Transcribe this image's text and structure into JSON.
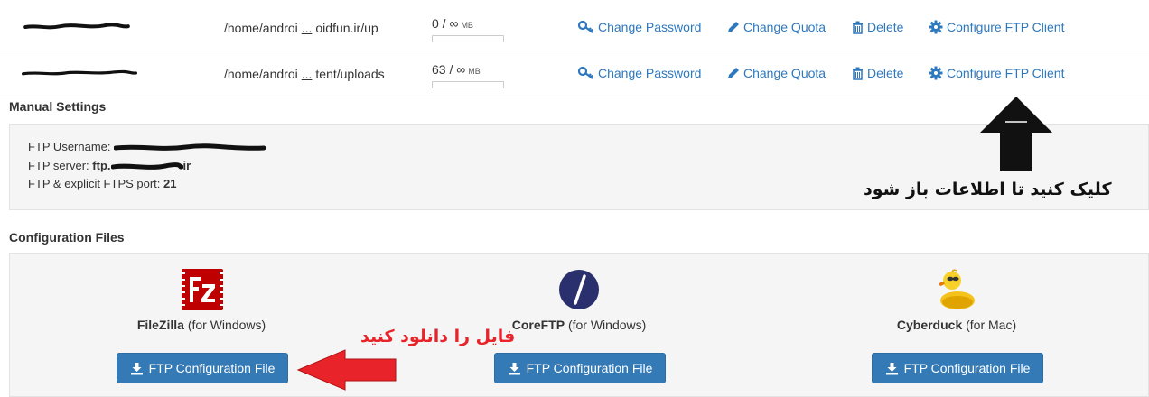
{
  "accounts": [
    {
      "path_start": "/home/androi",
      "path_ellipsis": "...",
      "path_end": "oidfun.ir/up",
      "quota_text": "0 / ∞",
      "quota_unit": "MB",
      "quota_fraction": 0
    },
    {
      "path_start": "/home/androi",
      "path_ellipsis": "...",
      "path_end": "tent/uploads",
      "quota_text": "63 / ∞",
      "quota_unit": "MB",
      "quota_fraction": 0
    }
  ],
  "actions": {
    "change_password": "Change Password",
    "change_quota": "Change Quota",
    "delete": "Delete",
    "configure_ftp": "Configure FTP Client"
  },
  "manual": {
    "title": "Manual Settings",
    "username_label": "FTP Username:",
    "server_label": "FTP server:",
    "server_value_prefix": "ftp.",
    "server_value_suffix": "ir",
    "port_label": "FTP & explicit FTPS port:",
    "port_value": "21"
  },
  "annotations": {
    "click_hint": "کلیک کنید تا اطلاعات باز شود",
    "download_hint": "فایل را دانلود کنید"
  },
  "config": {
    "title": "Configuration Files",
    "clients": [
      {
        "name": "FileZilla",
        "platform": "(for Windows)",
        "icon": "filezilla-icon"
      },
      {
        "name": "CoreFTP",
        "platform": "(for Windows)",
        "icon": "coreftp-icon"
      },
      {
        "name": "Cyberduck",
        "platform": "(for Mac)",
        "icon": "cyberduck-icon"
      }
    ],
    "button_label": "FTP Configuration File"
  },
  "colors": {
    "link": "#2e78bd",
    "button": "#337ab7",
    "annotation_red": "#e8242a",
    "filezilla_red": "#bf0000",
    "coreftp_navy": "#2a2f6e"
  }
}
